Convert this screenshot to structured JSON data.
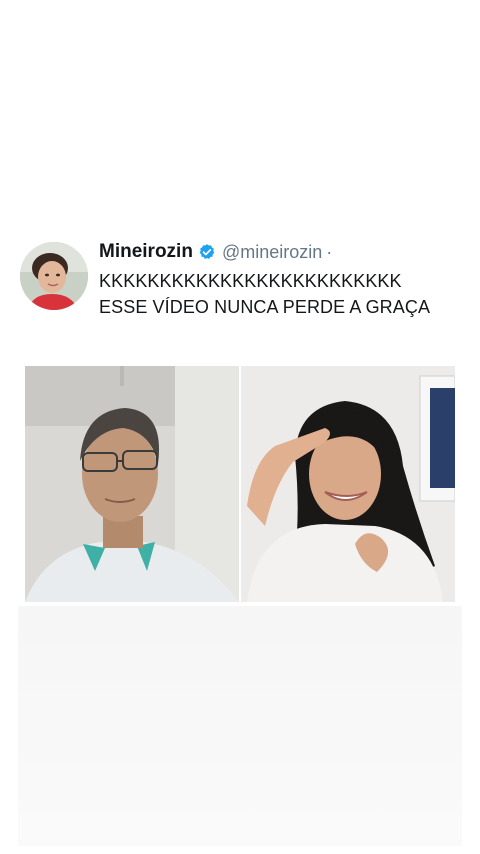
{
  "tweet": {
    "display_name": "Mineirozin",
    "handle": "@mineirozin",
    "separator": "·",
    "text_line_1": "KKKKKKKKKKKKKKKKKKKKKKKKK",
    "text_line_2": "ESSE VÍDEO NUNCA PERDE A GRAÇA",
    "verified": true,
    "verified_color": "#1da1f2"
  },
  "media": {
    "left_person": "man-with-glasses",
    "right_person": "woman-smiling"
  },
  "icons": {
    "verified": "verified-badge-icon"
  }
}
